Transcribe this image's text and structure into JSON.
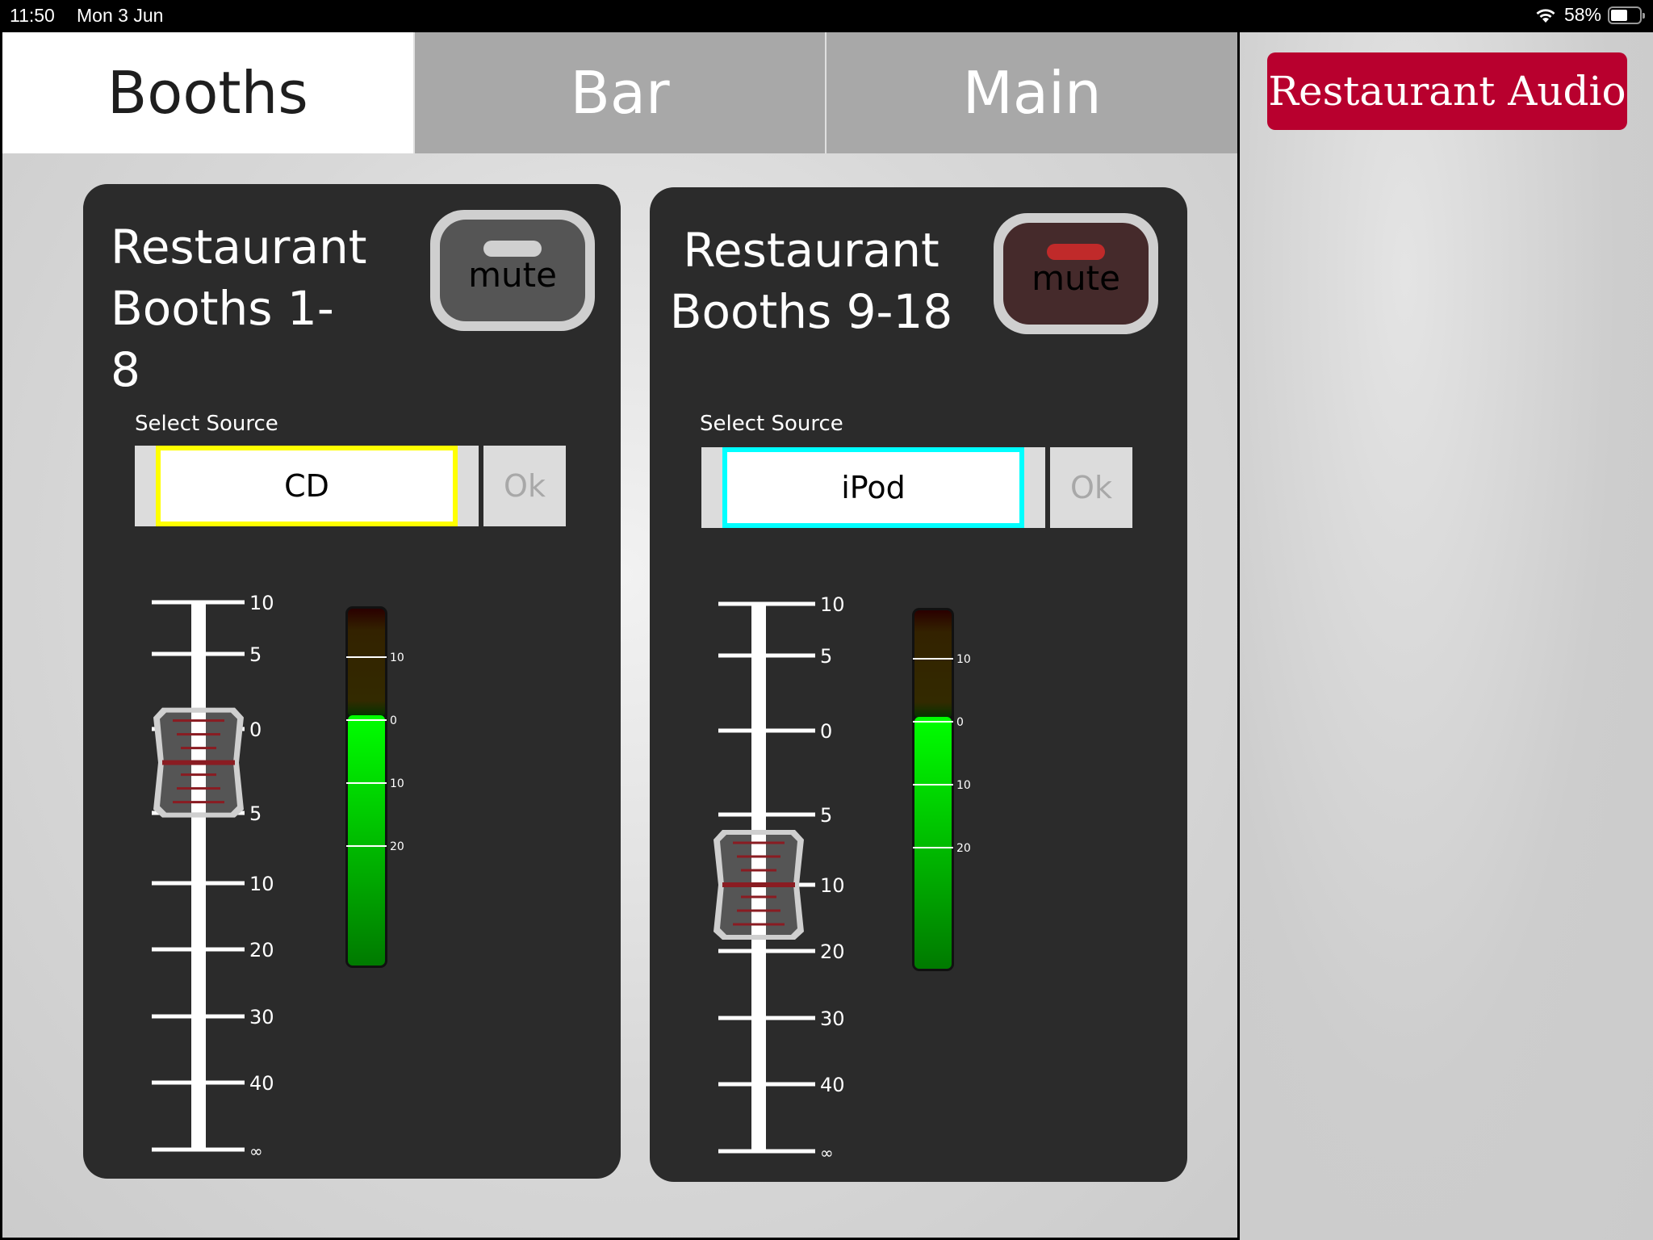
{
  "status_bar": {
    "time": "11:50",
    "date": "Mon 3 Jun",
    "battery_text": "58%",
    "battery_level": 0.58,
    "wifi_icon": "wifi-icon"
  },
  "tabs": [
    {
      "label": "Booths",
      "active": true
    },
    {
      "label": "Bar",
      "active": false
    },
    {
      "label": "Main",
      "active": false
    }
  ],
  "app_title": "Restaurant Audio",
  "colors": {
    "brand": "#b8002e",
    "panel_bg": "#2b2b2b",
    "tab_active": "#ffffff",
    "tab_inactive": "#a8a8a8",
    "select_focus_yellow": "#ffff00",
    "select_focus_cyan": "#00ffff",
    "mute_off_bg": "#555555",
    "mute_on_bg": "#452a2b",
    "mute_led_off": "#d0d0d0",
    "mute_led_on": "#c02a2a",
    "meter_green": "#00ff00"
  },
  "zones": [
    {
      "title_line1": "Restaurant",
      "title_line2": "Booths 1-8",
      "mute_label": "mute",
      "muted": false,
      "source_label": "Select Source",
      "source_value": "CD",
      "source_border": "#ffff00",
      "ok_label": "Ok",
      "fader_scale": [
        "10",
        "5",
        "0",
        "5",
        "10",
        "20",
        "30",
        "40",
        "∞"
      ],
      "fader_db": -2,
      "meter_scale": [
        "10",
        "0",
        "10",
        "20"
      ],
      "meter_level_db": 0
    },
    {
      "title_line1": "Restaurant",
      "title_line2": "Booths 9-18",
      "mute_label": "mute",
      "muted": true,
      "source_label": "Select Source",
      "source_value": "iPod",
      "source_border": "#00ffff",
      "ok_label": "Ok",
      "fader_scale": [
        "10",
        "5",
        "0",
        "5",
        "10",
        "20",
        "30",
        "40",
        "∞"
      ],
      "fader_db": -10,
      "meter_scale": [
        "10",
        "0",
        "10",
        "20"
      ],
      "meter_level_db": 0
    }
  ]
}
